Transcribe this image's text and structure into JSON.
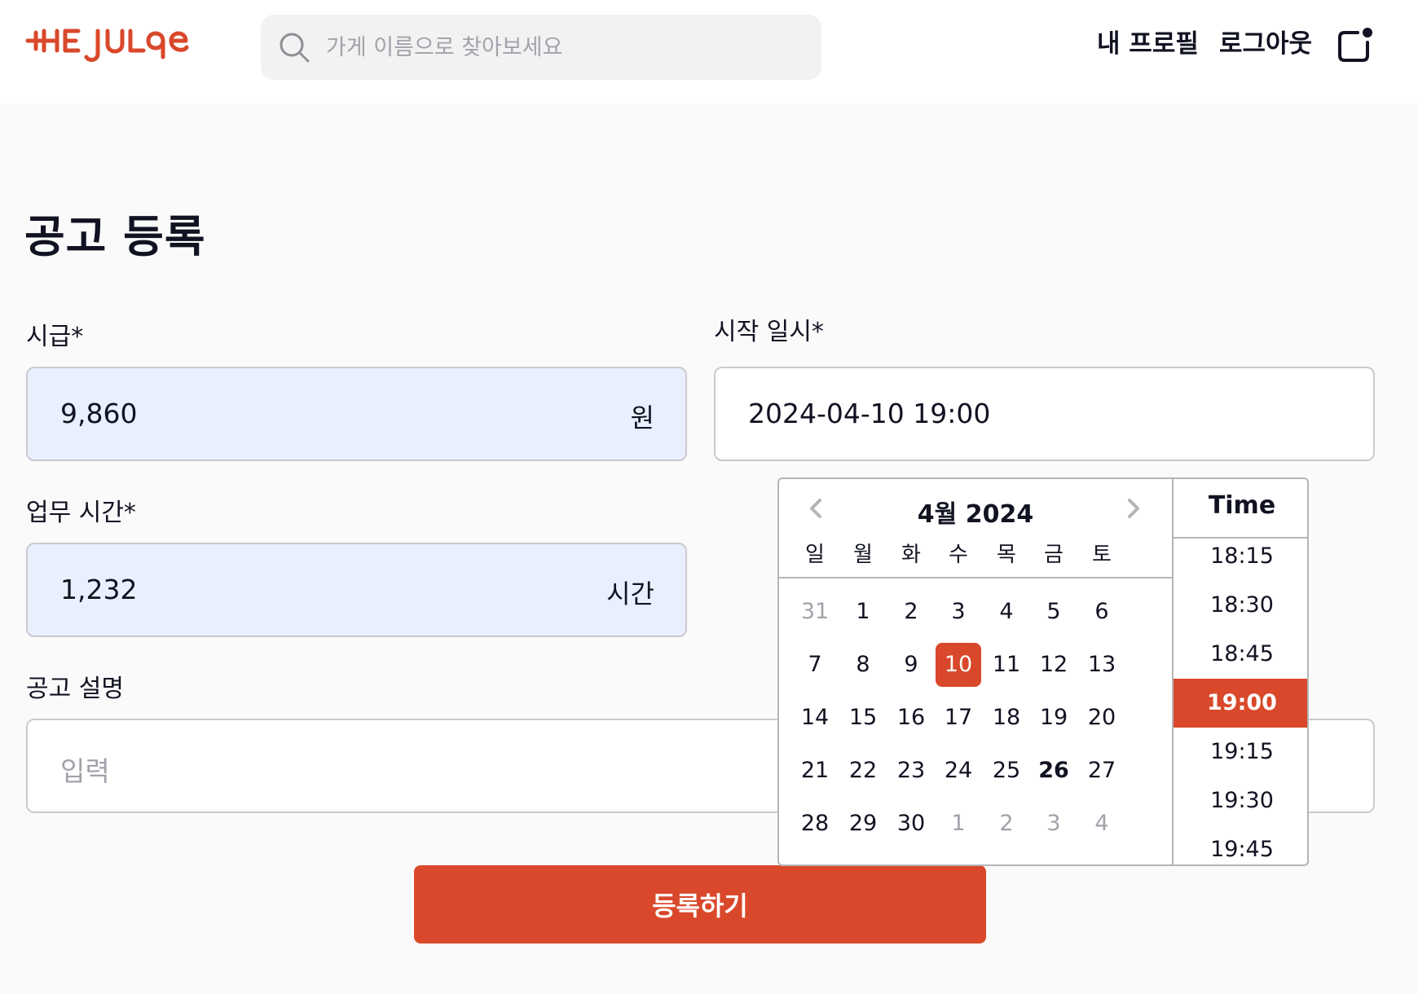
{
  "header": {
    "logo_text": "THE JULGE",
    "search_placeholder": "가게 이름으로 찾아보세요",
    "nav_profile": "내 프로필",
    "nav_logout": "로그아웃",
    "brand_color": "#d9482b"
  },
  "page": {
    "title": "공고 등록",
    "wage": {
      "label": "시급*",
      "value": "9,860",
      "unit": "원"
    },
    "start": {
      "label": "시작 일시*",
      "value": "2024-04-10 19:00"
    },
    "hours": {
      "label": "업무 시간*",
      "value": "1,232",
      "unit": "시간"
    },
    "description": {
      "label": "공고 설명",
      "placeholder": "입력"
    },
    "submit_label": "등록하기"
  },
  "datepicker": {
    "month_title": "4월 2024",
    "weekdays": [
      "일",
      "월",
      "화",
      "수",
      "목",
      "금",
      "토"
    ],
    "weeks": [
      [
        {
          "d": "31",
          "m": true
        },
        {
          "d": "1"
        },
        {
          "d": "2"
        },
        {
          "d": "3"
        },
        {
          "d": "4"
        },
        {
          "d": "5"
        },
        {
          "d": "6"
        }
      ],
      [
        {
          "d": "7"
        },
        {
          "d": "8"
        },
        {
          "d": "9"
        },
        {
          "d": "10",
          "sel": true
        },
        {
          "d": "11"
        },
        {
          "d": "12"
        },
        {
          "d": "13"
        }
      ],
      [
        {
          "d": "14"
        },
        {
          "d": "15"
        },
        {
          "d": "16"
        },
        {
          "d": "17"
        },
        {
          "d": "18"
        },
        {
          "d": "19"
        },
        {
          "d": "20"
        }
      ],
      [
        {
          "d": "21"
        },
        {
          "d": "22"
        },
        {
          "d": "23"
        },
        {
          "d": "24"
        },
        {
          "d": "25"
        },
        {
          "d": "26",
          "today": true
        },
        {
          "d": "27"
        }
      ],
      [
        {
          "d": "28"
        },
        {
          "d": "29"
        },
        {
          "d": "30"
        },
        {
          "d": "1",
          "m": true
        },
        {
          "d": "2",
          "m": true
        },
        {
          "d": "3",
          "m": true
        },
        {
          "d": "4",
          "m": true
        }
      ]
    ],
    "time_header": "Time",
    "times": [
      "18:15",
      "18:30",
      "18:45",
      "19:00",
      "19:15",
      "19:30",
      "19:45"
    ],
    "selected_time": "19:00"
  }
}
